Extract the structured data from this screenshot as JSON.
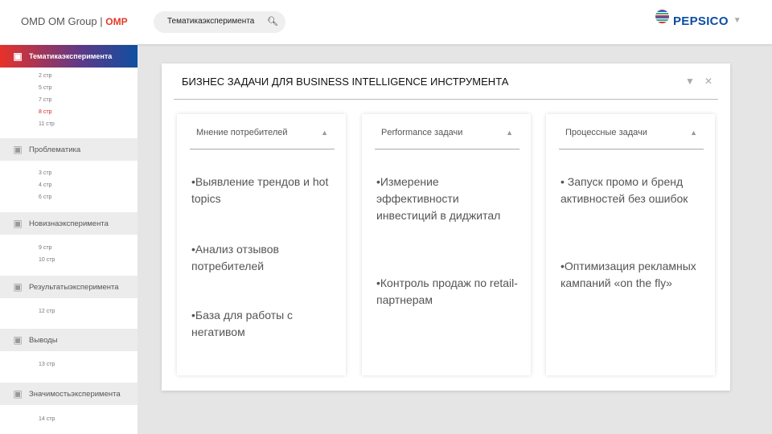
{
  "header": {
    "logo_text": "OMD OM Group",
    "logo_mark": "OMP",
    "search_value": "Тематикаэксперимента",
    "brand": "PEPSICO"
  },
  "sidebar": [
    {
      "label": "Тематикаэксперимента",
      "icon": "book-icon",
      "active": true,
      "pages": [
        "2 стр",
        "5 стр",
        "7 стр",
        "8 стр",
        "11 стр"
      ],
      "current": "8 стр"
    },
    {
      "label": "Проблематика",
      "icon": "people-idea-icon",
      "pages": [
        "3 стр",
        "4 стр",
        "6 стр"
      ]
    },
    {
      "label": "Новизнаэксперимента",
      "icon": "sparkle-icon",
      "pages": [
        "9 стр",
        "10 стр"
      ]
    },
    {
      "label": "Результатыэксперимента",
      "icon": "envelope-icon",
      "pages": [
        "12 стр"
      ]
    },
    {
      "label": "Выводы",
      "icon": "map-icon",
      "pages": [
        "13 стр"
      ]
    },
    {
      "label": "Значимостьэксперимента",
      "icon": "trophy-icon",
      "pages": [
        "14 стр"
      ]
    }
  ],
  "card": {
    "title": "БИЗНЕС ЗАДАЧИ ДЛЯ BUSINESS INTELLIGENCE ИНСТРУМЕНТА",
    "columns": [
      {
        "header": "Мнение потребителей",
        "items": [
          "•Выявление трендов и hot topics",
          "•Анализ отзывов потребителей",
          "•База для работы с негативом"
        ]
      },
      {
        "header": "Performance задачи",
        "items": [
          "•Измерение эффективности инвестиций в диджитал",
          "•Контроль продаж по retail-партнерам"
        ]
      },
      {
        "header": "Процессные задачи",
        "items": [
          "• Запуск промо и бренд активностей без ошибок",
          "•Оптимизация рекламных кампаний «on the fly»"
        ]
      }
    ]
  }
}
